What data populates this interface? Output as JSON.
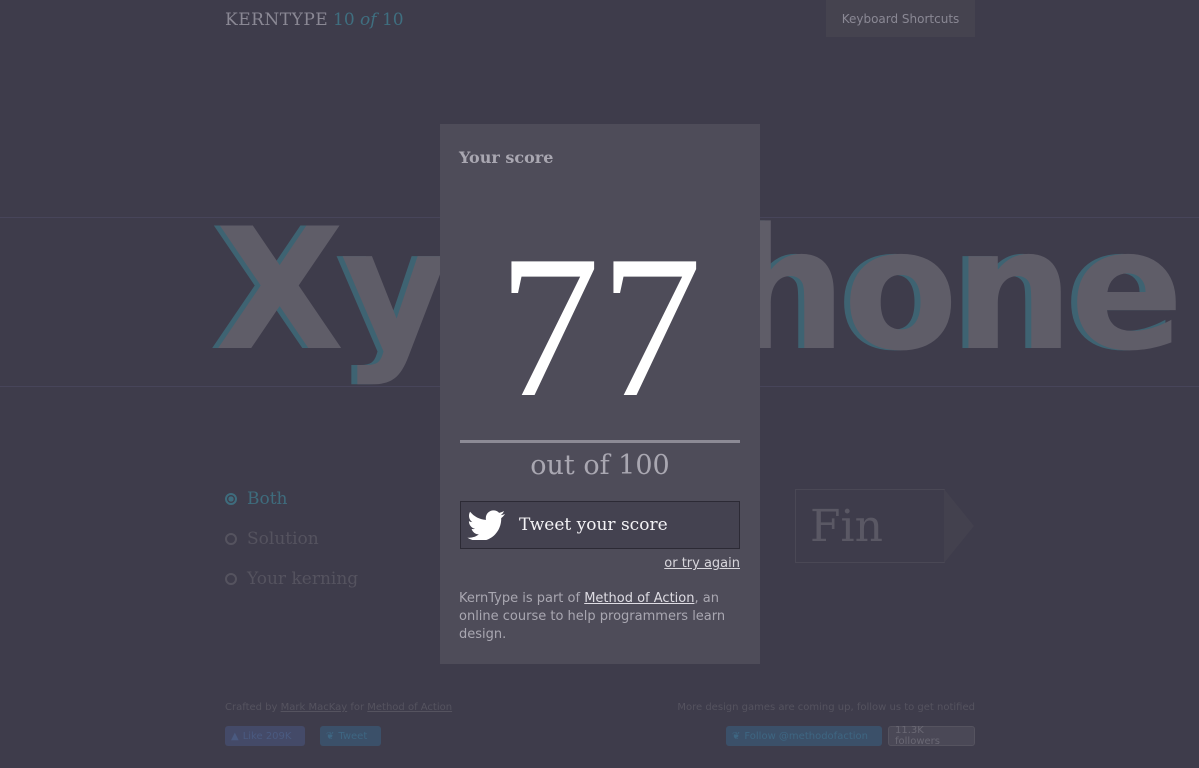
{
  "header": {
    "brand": "KERNTYPE",
    "progress_current": "10",
    "progress_of": "of",
    "progress_total": "10",
    "shortcuts_label": "Keyboard Shortcuts"
  },
  "game": {
    "word": "Xylophone"
  },
  "options": [
    {
      "label": "Both",
      "selected": true
    },
    {
      "label": "Solution",
      "selected": false
    },
    {
      "label": "Your kerning",
      "selected": false
    }
  ],
  "fin_label": "Fin",
  "modal": {
    "title": "Your score",
    "score": "77",
    "out_of": "out of 100",
    "tweet_label": "Tweet your score",
    "try_again": "or try again",
    "about_prefix": "KernType is part of ",
    "about_link": "Method of Action",
    "about_suffix": ", an online course to help programmers learn design."
  },
  "footer": {
    "crafted_prefix": "Crafted by ",
    "author": "Mark MacKay",
    "crafted_mid": " for ",
    "org": "Method of Action",
    "more_games": "More design games are coming up, follow us to get notified",
    "like_label": "Like 209K",
    "tweet_label": "Tweet",
    "follow_label": "Follow @methodofaction",
    "followers": "11.3K followers"
  },
  "colors": {
    "background": "#3e3c4b",
    "modal": "#4e4c59",
    "accent": "#3e6c7d"
  }
}
